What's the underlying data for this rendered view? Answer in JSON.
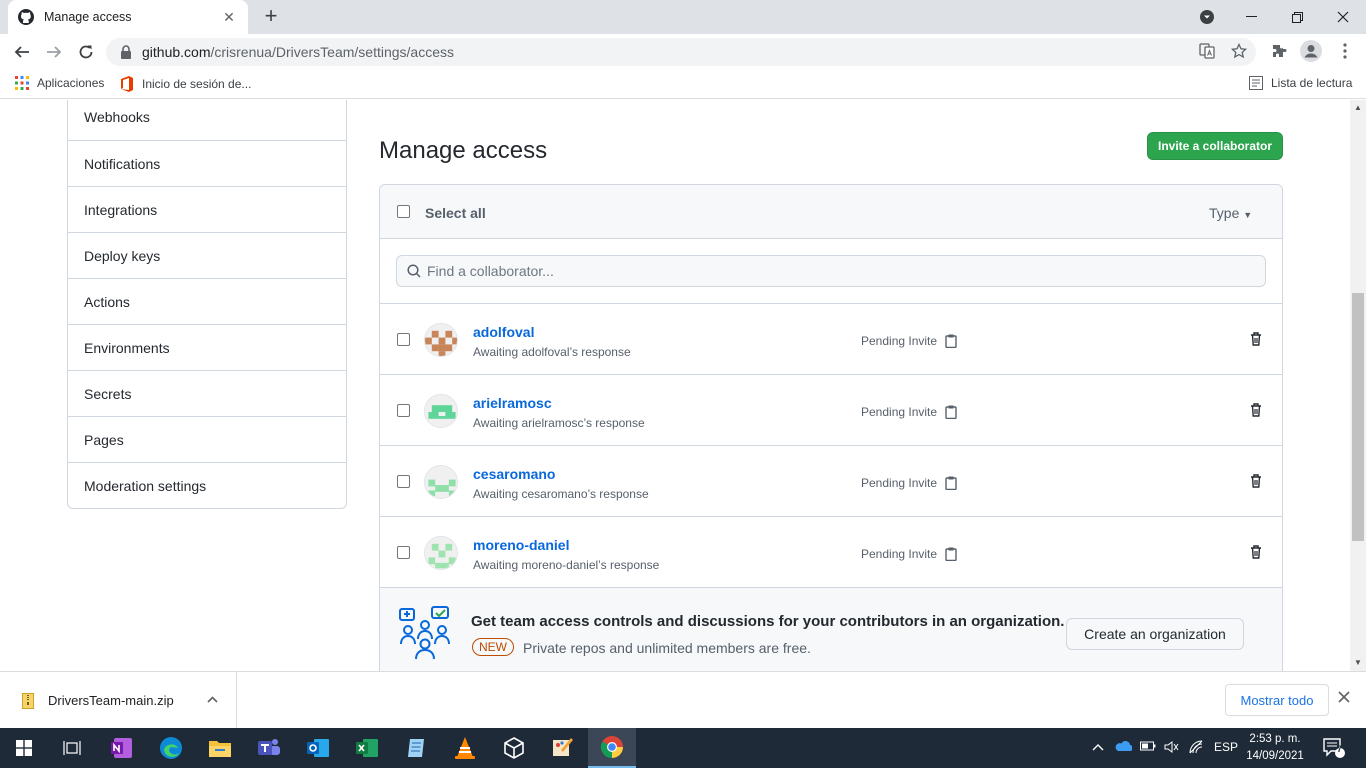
{
  "browser": {
    "tab_title": "Manage access",
    "url_host": "github.com",
    "url_path": "/crisrenua/DriversTeam/settings/access",
    "bookmarks": {
      "apps_label": "Aplicaciones",
      "office_label": "Inicio de sesión de...",
      "reading_list_label": "Lista de lectura"
    }
  },
  "sidebar": {
    "items": [
      {
        "label": "Webhooks"
      },
      {
        "label": "Notifications"
      },
      {
        "label": "Integrations"
      },
      {
        "label": "Deploy keys"
      },
      {
        "label": "Actions"
      },
      {
        "label": "Environments"
      },
      {
        "label": "Secrets"
      },
      {
        "label": "Pages"
      },
      {
        "label": "Moderation settings"
      }
    ]
  },
  "main": {
    "title": "Manage access",
    "invite_button": "Invite a collaborator",
    "select_all": "Select all",
    "type_filter": "Type",
    "search_placeholder": "Find a collaborator...",
    "collaborators": [
      {
        "username": "adolfoval",
        "status_text": "Awaiting adolfoval’s response",
        "invite_state": "Pending Invite",
        "avatar_color": "#c9855a"
      },
      {
        "username": "arielramosc",
        "status_text": "Awaiting arielramosc’s response",
        "invite_state": "Pending Invite",
        "avatar_color": "#5fd59a"
      },
      {
        "username": "cesaromano",
        "status_text": "Awaiting cesaromano’s response",
        "invite_state": "Pending Invite",
        "avatar_color": "#8fe0a8"
      },
      {
        "username": "moreno-daniel",
        "status_text": "Awaiting moreno-daniel’s response",
        "invite_state": "Pending Invite",
        "avatar_color": "#9ee3b0"
      }
    ],
    "promo": {
      "headline": "Get team access controls and discussions for your contributors in an organization.",
      "badge": "NEW",
      "subtext": "Private repos and unlimited members are free.",
      "button": "Create an organization"
    }
  },
  "downloads": {
    "file_name": "DriversTeam-main.zip",
    "show_all": "Mostrar todo"
  },
  "taskbar": {
    "language": "ESP",
    "time": "2:53 p. m.",
    "date": "14/09/2021",
    "notification_count": "7"
  },
  "colors": {
    "primary_button": "#2da44e",
    "link": "#0969da",
    "badge": "#bc4c00"
  }
}
